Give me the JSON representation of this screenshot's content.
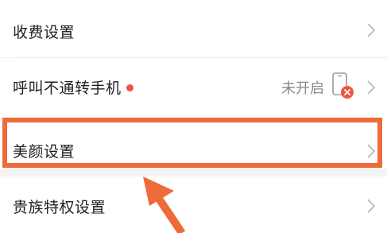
{
  "settings": {
    "items": [
      {
        "label": "收费设置"
      },
      {
        "label": "呼叫不通转手机",
        "status": "未开启",
        "has_dot": true
      },
      {
        "label": "美颜设置"
      },
      {
        "label": "贵族特权设置"
      }
    ]
  },
  "colors": {
    "highlight": "#ef6a3a",
    "dot": "#f0533f",
    "status_text": "#8a8a8a"
  },
  "icons": {
    "chevron": "chevron-right-icon",
    "phone_off": "phone-disabled-icon",
    "annotation_arrow": "annotation-arrow"
  }
}
